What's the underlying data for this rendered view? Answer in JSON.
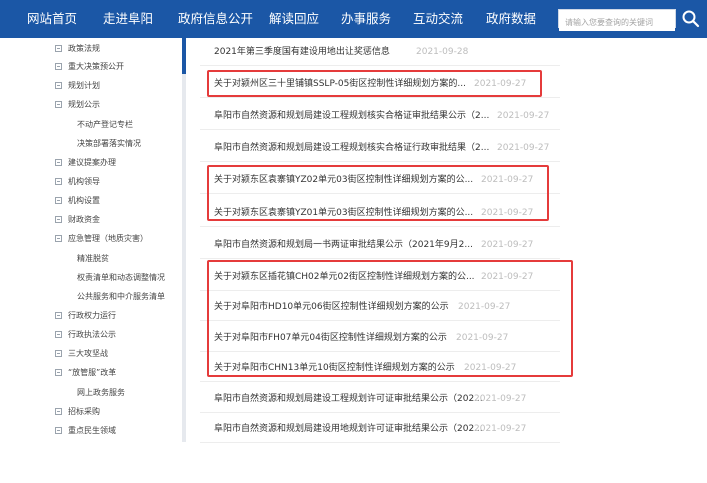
{
  "nav": {
    "items": [
      "网站首页",
      "走进阜阳",
      "政府信息公开",
      "解读回应",
      "办事服务",
      "互动交流",
      "政府数据"
    ],
    "search_placeholder": "请输入您要查询的关键词",
    "search_icon": "search-icon"
  },
  "sidebar": {
    "items": [
      {
        "label": "政策法规",
        "type": "item"
      },
      {
        "label": "重大决策预公开",
        "type": "item"
      },
      {
        "label": "规划计划",
        "type": "item"
      },
      {
        "label": "规划公示",
        "type": "item"
      },
      {
        "label": "不动产登记专栏",
        "type": "sub"
      },
      {
        "label": "决策部署落实情况",
        "type": "sub"
      },
      {
        "label": "建议提案办理",
        "type": "item"
      },
      {
        "label": "机构领导",
        "type": "item"
      },
      {
        "label": "机构设置",
        "type": "item"
      },
      {
        "label": "财政资金",
        "type": "item"
      },
      {
        "label": "应急管理（地质灾害）",
        "type": "item"
      },
      {
        "label": "精准脱贫",
        "type": "sub"
      },
      {
        "label": "权责清单和动态调整情况",
        "type": "sub"
      },
      {
        "label": "公共服务和中介服务清单",
        "type": "sub"
      },
      {
        "label": "行政权力运行",
        "type": "item"
      },
      {
        "label": "行政执法公示",
        "type": "item"
      },
      {
        "label": "三大攻坚战",
        "type": "item"
      },
      {
        "label": "“放管服”改革",
        "type": "item"
      },
      {
        "label": "网上政务服务",
        "type": "sub"
      },
      {
        "label": "招标采购",
        "type": "item"
      },
      {
        "label": "重点民生领域",
        "type": "item"
      }
    ]
  },
  "list": {
    "rows": [
      {
        "title": "2021年第三季度国有建设用地出让奖惩信息",
        "date": "2021-09-28"
      },
      {
        "title": "关于对颍州区三十里铺镇SSLP-05街区控制性详细规划方案的...",
        "date": "2021-09-27"
      },
      {
        "title": "阜阳市自然资源和规划局建设工程规划核实合格证审批结果公示（2...",
        "date": "2021-09-27"
      },
      {
        "title": "阜阳市自然资源和规划局建设工程规划核实合格证行政审批结果（2...",
        "date": "2021-09-27"
      },
      {
        "title": "关于对颍东区袁寨镇YZ02单元03街区控制性详细规划方案的公...",
        "date": "2021-09-27"
      },
      {
        "title": "关于对颍东区袁寨镇YZ01单元03街区控制性详细规划方案的公...",
        "date": "2021-09-27"
      },
      {
        "title": "阜阳市自然资源和规划局一书两证审批结果公示（2021年9月2...",
        "date": "2021-09-27"
      },
      {
        "title": "关于对颍东区插花镇CH02单元02街区控制性详细规划方案的公...",
        "date": "2021-09-27"
      },
      {
        "title": "关于对阜阳市HD10单元06街区控制性详细规划方案的公示",
        "date": "2021-09-27"
      },
      {
        "title": "关于对阜阳市FH07单元04街区控制性详细规划方案的公示",
        "date": "2021-09-27"
      },
      {
        "title": "关于对阜阳市CHN13单元10街区控制性详细规划方案的公示",
        "date": "2021-09-27"
      },
      {
        "title": "阜阳市自然资源和规划局建设工程规划许可证审批结果公示（202...",
        "date": "2021-09-27"
      },
      {
        "title": "阜阳市自然资源和规划局建设用地规划许可证审批结果公示（202...",
        "date": "2021-09-27"
      }
    ]
  },
  "colors": {
    "nav_bg": "#1b57a6",
    "highlight": "#e53b3b",
    "date": "#bdbdbd"
  }
}
